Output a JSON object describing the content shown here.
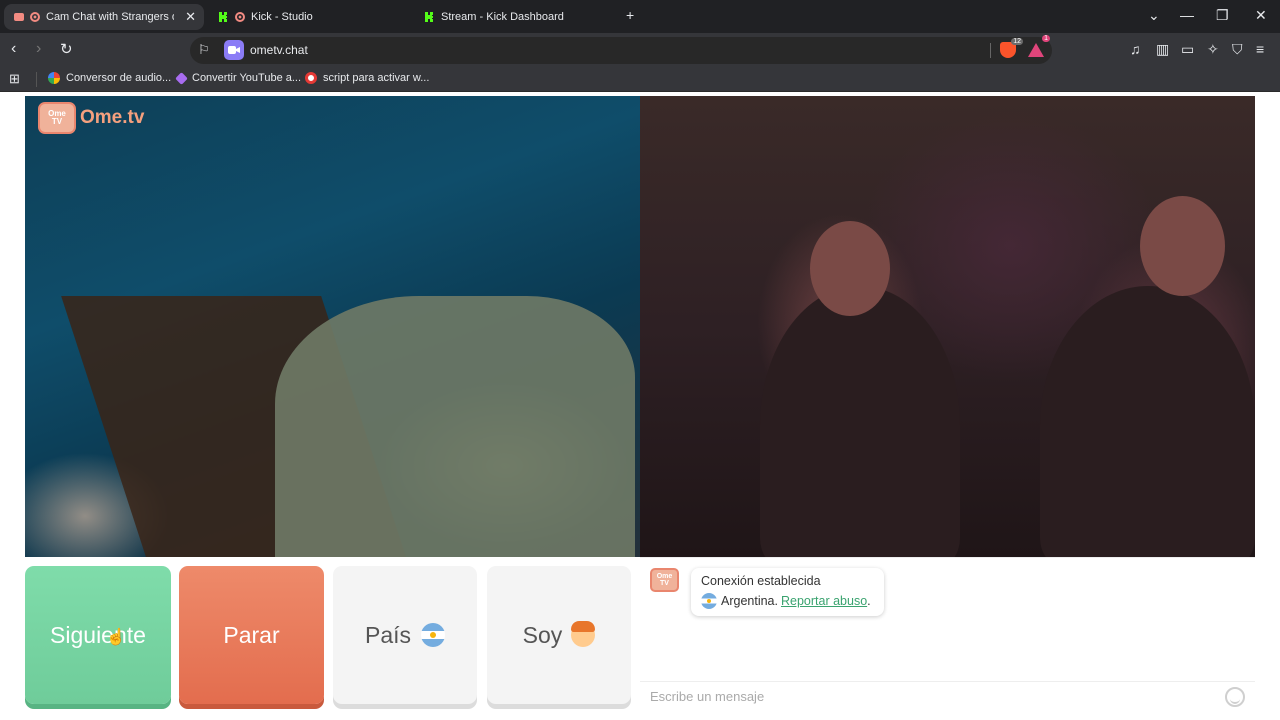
{
  "browser": {
    "tabs": [
      {
        "title": "Cam Chat with Strangers on O",
        "active": true
      },
      {
        "title": "Kick - Studio",
        "active": false
      },
      {
        "title": "Stream - Kick Dashboard",
        "active": false
      }
    ],
    "new_tab": "+",
    "window_controls": {
      "minimize": "—",
      "maximize": "❐",
      "close": "✕",
      "tab_list": "⌄"
    },
    "url": "ometv.chat",
    "brave_shield_count": "12",
    "rewards_count": "1",
    "bookmarks": [
      {
        "label": "Conversor de audio..."
      },
      {
        "label": "Convertir YouTube a..."
      },
      {
        "label": "script para activar w..."
      }
    ]
  },
  "app": {
    "logo_tv_top": "Ome",
    "logo_tv_bottom": "TV",
    "logo_text": "Ome.tv",
    "buttons": {
      "next": "Siguiente",
      "stop": "Parar",
      "country": "País",
      "gender": "Soy"
    },
    "chat": {
      "status": "Conexión establecida",
      "country": "Argentina.",
      "report": "Reportar abuso",
      "report_suffix": ".",
      "input_placeholder": "Escribe un mensaje"
    }
  },
  "colors": {
    "next_button": "#6fcc9a",
    "stop_button": "#e36d4e",
    "link": "#3aa36f"
  }
}
